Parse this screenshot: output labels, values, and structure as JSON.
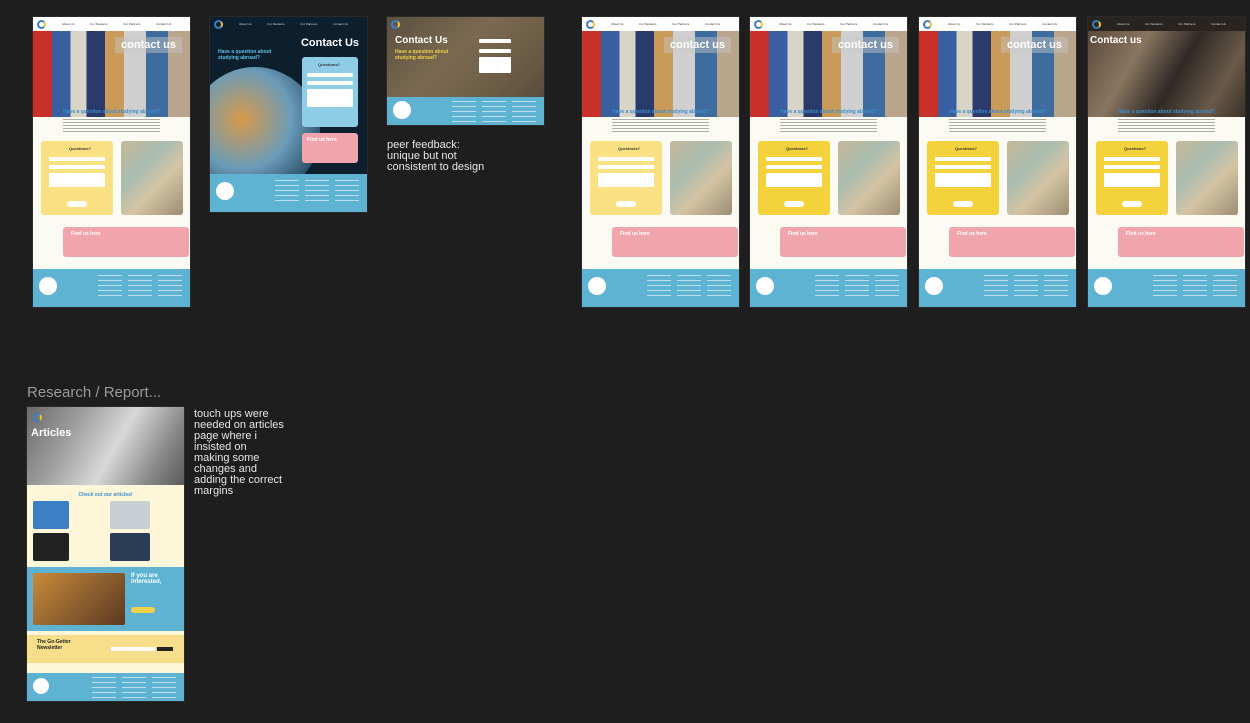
{
  "nav": {
    "links": [
      "About Us",
      "For Students",
      "For Partners",
      "Contact Us"
    ]
  },
  "frames": {
    "contact_a": {
      "hero_title": "contact us",
      "question": "Have a question about studying abroad?",
      "form_title": "Questions?",
      "find_title": "Find us here"
    },
    "contact_dark": {
      "hero_title": "Contact Us",
      "question": "Have a question about studying abroad?",
      "form_title": "Questions?",
      "find_title": "Find us here"
    },
    "contact_map": {
      "hero_title": "Contact Us",
      "question": "Have a question about studying abroad?"
    },
    "contact_b": {
      "hero_title": "contact us",
      "question": "Have a question about studying abroad?",
      "form_title": "Questions?",
      "find_title": "Find us here"
    },
    "contact_c": {
      "hero_title": "contact us",
      "question": "Have a question about studying abroad?",
      "form_title": "Questions?",
      "find_title": "Find us here"
    },
    "contact_d": {
      "hero_title": "contact us",
      "question": "Have a question about studying abroad?",
      "form_title": "Questions?",
      "find_title": "Find us here"
    },
    "contact_e": {
      "hero_title": "Contact us",
      "question": "Have a question about studying abroad?",
      "form_title": "Questions?",
      "find_title": "Find us here"
    },
    "articles": {
      "hero_title": "Articles",
      "check_out": "Check out our articles!",
      "interested": "If you are interested,",
      "newsletter": "The Go-Getter Newsletter"
    }
  },
  "notes": {
    "peer_feedback": "peer feedback:\nunique but not\nconsistent to design",
    "touch_ups": "touch ups were\nneeded on articles\npage where i\ninsisted on\nmaking some\nchanges and\nadding the correct\nmargins"
  },
  "section_label": "Research / Report..."
}
